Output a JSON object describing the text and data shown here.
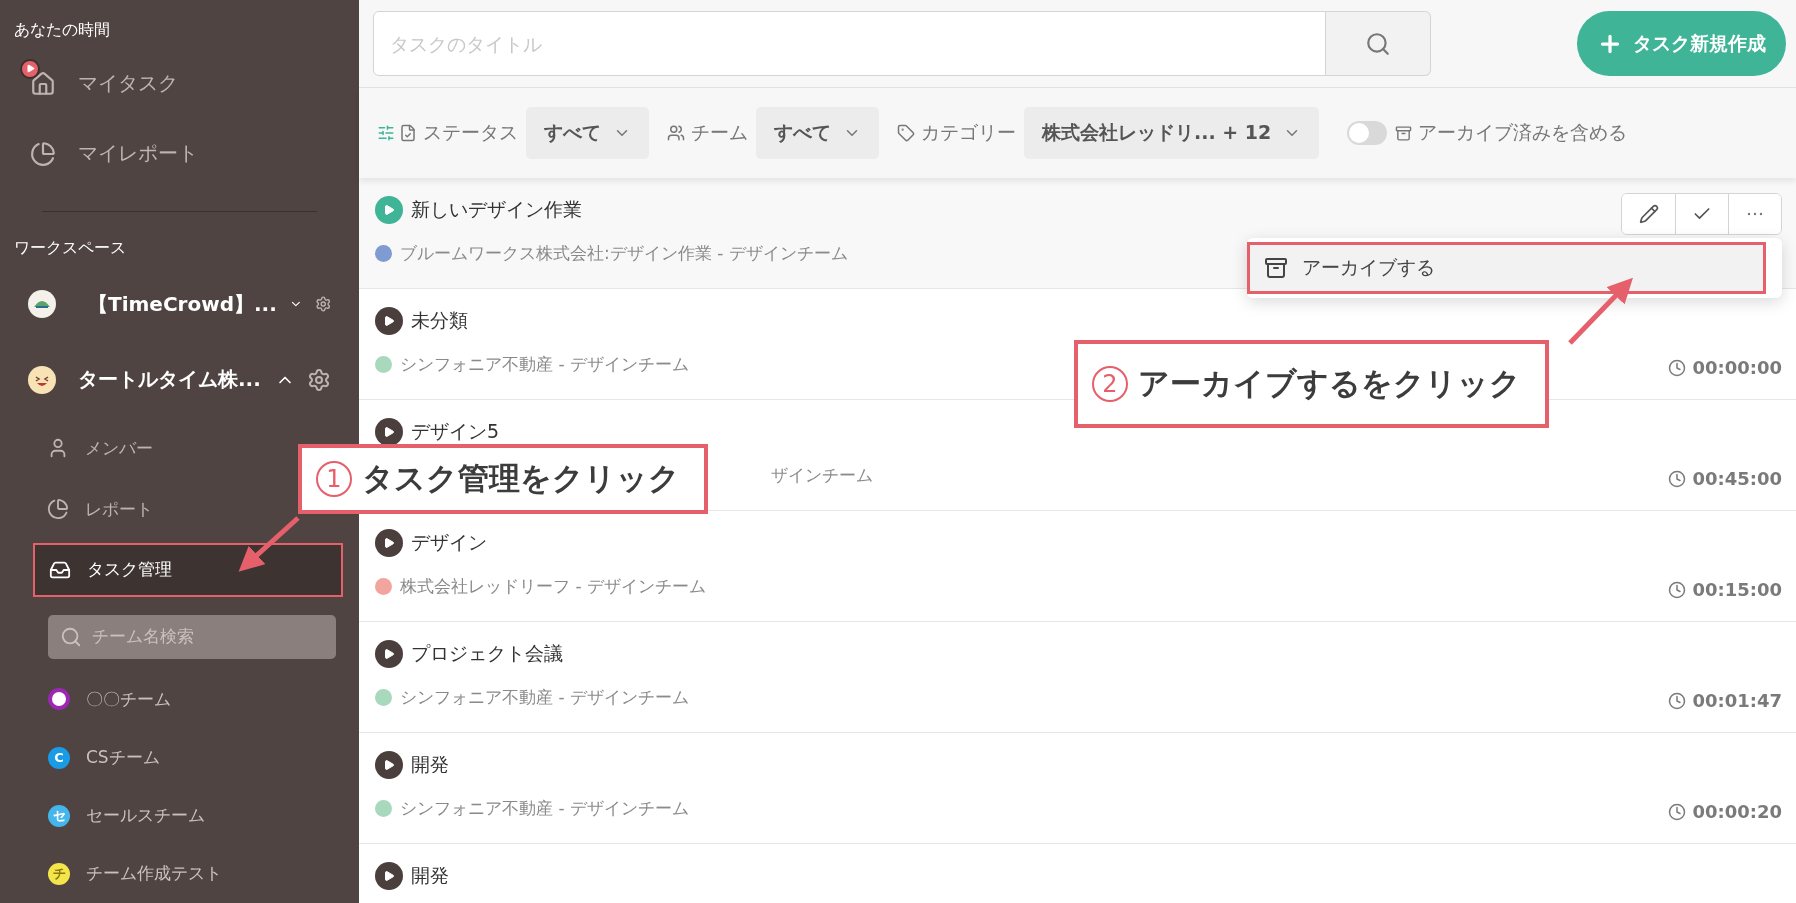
{
  "sidebar": {
    "personal_heading": "あなたの時間",
    "personal_items": [
      {
        "label": "マイタスク",
        "running": true
      },
      {
        "label": "マイレポート",
        "running": false
      }
    ],
    "workspace_heading": "ワークスペース",
    "workspaces": [
      {
        "name": "【TimeCrowd】...",
        "expanded": false
      },
      {
        "name": "タートルタイム株...",
        "expanded": true
      }
    ],
    "workspace_menu": [
      {
        "label": "メンバー",
        "selected": false
      },
      {
        "label": "レポート",
        "selected": false
      },
      {
        "label": "タスク管理",
        "selected": true
      }
    ],
    "team_search": {
      "placeholder": "チーム名検索"
    },
    "teams": [
      {
        "label": "〇〇チーム",
        "color": "#9c27b0"
      },
      {
        "label": "CSチーム",
        "initial": "C",
        "color": "#1a9be6"
      },
      {
        "label": "セールスチーム",
        "initial": "セ",
        "color": "#45b6ec"
      },
      {
        "label": "チーム作成テスト",
        "initial": "チ",
        "color": "#f4e64a"
      }
    ]
  },
  "search": {
    "placeholder": "タスクのタイトル"
  },
  "new_task_button": {
    "label": "タスク新規作成"
  },
  "filters": [
    {
      "label": "ステータス",
      "value": "すべて"
    },
    {
      "label": "チーム",
      "value": "すべて"
    },
    {
      "label": "カテゴリー",
      "value": "株式会社レッドリ... + 12"
    }
  ],
  "archive_toggle": {
    "label": "アーカイブ済みを含める",
    "on": false
  },
  "tasks": [
    {
      "kind": "normal",
      "title": "新しいデザイン作業",
      "category": "ブルームワークス株式会社:デザイン作業 - デザインチーム",
      "color": "#7f9bd1",
      "running": true,
      "hovered": true
    },
    {
      "kind": "normal",
      "title": "未分類",
      "category": "シンフォニア不動産 - デザインチーム",
      "color": "#a8d9bd",
      "time": "00:00:00",
      "running": false,
      "hovered": false
    },
    {
      "kind": "covered",
      "title": "デザイン5",
      "category": "ザインチーム",
      "time": "00:45:00",
      "running": false,
      "hovered": false
    },
    {
      "kind": "normal",
      "title": "デザイン",
      "category": "株式会社レッドリーフ - デザインチーム",
      "color": "#f2a59f",
      "time": "00:15:00",
      "running": false,
      "hovered": false
    },
    {
      "kind": "normal",
      "title": "プロジェクト会議",
      "category": "シンフォニア不動産 - デザインチーム",
      "color": "#a8d9bd",
      "time": "00:01:47",
      "running": false,
      "hovered": false
    },
    {
      "kind": "normal",
      "title": "開発",
      "category": "シンフォニア不動産 - デザインチーム",
      "color": "#a8d9bd",
      "time": "00:00:20",
      "running": false,
      "hovered": false
    },
    {
      "kind": "normal",
      "title": "開発",
      "running": false,
      "hovered": false
    }
  ],
  "task_menu": {
    "items": [
      {
        "label": "アーカイブする",
        "highlighted": true
      }
    ]
  },
  "annotations": [
    {
      "number": "1",
      "text": "タスク管理をクリック"
    },
    {
      "number": "2",
      "text": "アーカイブするをクリック"
    }
  ]
}
